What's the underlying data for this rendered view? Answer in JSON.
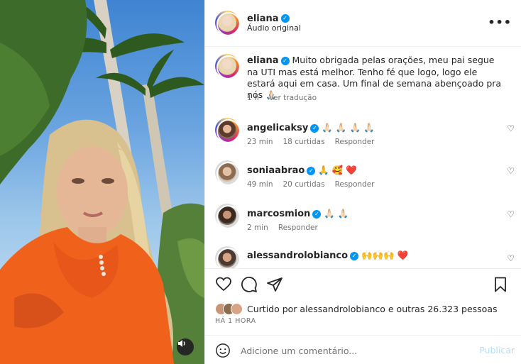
{
  "post": {
    "author": "eliana",
    "audio": "Áudio original",
    "caption": "Muito obrigada pelas orações, meu pai segue na UTI mas está melhor. Tenho fé que logo, logo ele estará aqui em casa. Um final de semana abençoado pra nós 🙏🏻",
    "caption_time": "1 h",
    "see_translation": "Ver tradução",
    "more_icon": "more-icon"
  },
  "comments": [
    {
      "username": "angelicaksy",
      "text": "🙏🏻 🙏🏻 🙏🏻 🙏🏻",
      "time": "23 min",
      "likes": "18 curtidas",
      "reply": "Responder"
    },
    {
      "username": "soniaabrao",
      "text": "🙏 🥰 ❤️",
      "time": "49 min",
      "likes": "20 curtidas",
      "reply": "Responder"
    },
    {
      "username": "marcosmion",
      "text": "🙏🏻 🙏🏻",
      "time": "2 min",
      "likes": "",
      "reply": "Responder"
    },
    {
      "username": "alessandrolobianco",
      "text": "🙌🙌🙌 ❤️",
      "time": "",
      "likes": "",
      "reply": ""
    }
  ],
  "actions": {
    "liked_by": "Curtido por alessandrolobianco e outras 26.323 pessoas",
    "time_ago": "HÁ 1 HORA"
  },
  "composer": {
    "placeholder": "Adicione um comentário...",
    "publish": "Publicar"
  },
  "colors": {
    "verified": "#0095f6",
    "muted": "#737373",
    "publish_disabled": "#b2dffc",
    "heart_red": "#ed4956"
  }
}
